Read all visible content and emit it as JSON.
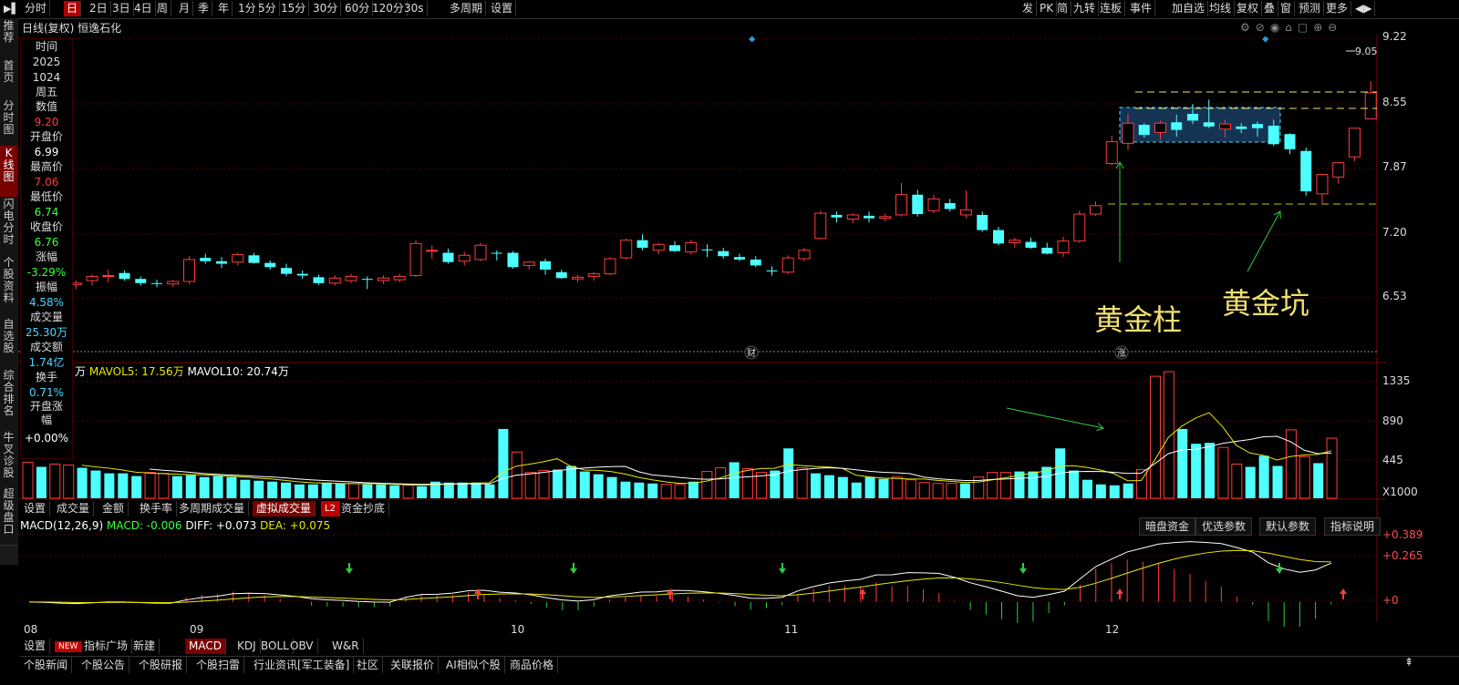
{
  "toolbar": {
    "left": [
      "分时",
      "日",
      "2日",
      "3日",
      "4日",
      "周",
      "月",
      "季",
      "年",
      "1分",
      "5分",
      "15分",
      "30分",
      "60分",
      "120分",
      "30s",
      "多周期",
      "设置"
    ],
    "active_index": 1,
    "right": [
      "发",
      "PK",
      "简",
      "九转",
      "连板",
      "事件",
      "加自选",
      "均线",
      "复权",
      "叠",
      "窗",
      "预测",
      "更多"
    ]
  },
  "leftnav": [
    "推荐",
    "首页",
    "分时图",
    "K线图",
    "闪电分时",
    "个股资料",
    "自选股",
    "综合排名",
    "牛叉诊股",
    "超级盘口"
  ],
  "leftnav_active": 3,
  "chart_title": "日线(复权)  恒逸石化",
  "info": {
    "time_label": "时间",
    "year": "2025",
    "date": "1024",
    "weekday": "周五",
    "value_label": "数值",
    "value": "9.20",
    "open_label": "开盘价",
    "open": "6.99",
    "high_label": "最高价",
    "high": "7.06",
    "low_label": "最低价",
    "low": "6.74",
    "close_label": "收盘价",
    "close": "6.76",
    "change_label": "涨幅",
    "change": "-3.29%",
    "amp_label": "振幅",
    "amp": "4.58%",
    "vol_label": "成交量",
    "vol": "25.30万",
    "amt_label": "成交额",
    "amt": "1.74亿",
    "turn_label": "换手",
    "turn": "0.71%",
    "ob_label": "开盘涨幅",
    "ob": "+0.00%"
  },
  "price_axis": [
    "9.22",
    "8.55",
    "7.87",
    "7.20",
    "6.53"
  ],
  "max_label": "9.05",
  "annotations": {
    "pillar": "黄金柱",
    "pit": "黄金坑",
    "cai": "财",
    "zhang": "涨"
  },
  "vol_legend": {
    "unit": "万",
    "mavol5": "MAVOL5: 17.56万",
    "mavol10": "MAVOL10: 20.74万"
  },
  "vol_axis": [
    "1335",
    "890",
    "445",
    "X1000"
  ],
  "vol_tabs": [
    "设置",
    "成交量",
    "金额",
    "换手率",
    "多周期成交量",
    "虚拟成交量",
    "L2",
    "资金抄底"
  ],
  "macd_legend": {
    "title": "MACD(12,26,9)",
    "macd": "MACD: -0.006",
    "diff": "DIFF: +0.073",
    "dea": "DEA: +0.075"
  },
  "macd_buttons": [
    "暗盘资金",
    "优选参数",
    "默认参数",
    "指标说明"
  ],
  "macd_axis": [
    "+0.389",
    "+0.265",
    "+0"
  ],
  "months": [
    "08",
    "09",
    "10",
    "11",
    "12"
  ],
  "indicator_tabs": [
    "设置",
    "NEW",
    "指标广场",
    "新建",
    "MACD",
    "KDJ",
    "BOLL",
    "OBV",
    "W&R"
  ],
  "bottom_tabs": [
    "个股新闻",
    "个股公告",
    "个股研报",
    "个股扫雷",
    "行业资讯[军工装备]",
    "社区",
    "关联报价",
    "AI相似个股",
    "商品价格"
  ],
  "chart_data": {
    "type": "candlestick",
    "price_ylim": [
      6.1,
      9.4
    ],
    "ohlc": [
      [
        6.48,
        6.55,
        6.4,
        6.52
      ],
      [
        6.55,
        6.6,
        6.48,
        6.49
      ],
      [
        6.53,
        6.62,
        6.43,
        6.45
      ],
      [
        6.45,
        6.5,
        6.4,
        6.47
      ],
      [
        6.5,
        6.57,
        6.44,
        6.55
      ],
      [
        6.55,
        6.63,
        6.48,
        6.56
      ],
      [
        6.59,
        6.62,
        6.5,
        6.52
      ],
      [
        6.52,
        6.55,
        6.44,
        6.47
      ],
      [
        6.47,
        6.51,
        6.42,
        6.46
      ],
      [
        6.46,
        6.51,
        6.42,
        6.49
      ],
      [
        6.49,
        6.79,
        6.46,
        6.75
      ],
      [
        6.77,
        6.82,
        6.7,
        6.73
      ],
      [
        6.73,
        6.78,
        6.65,
        6.7
      ],
      [
        6.72,
        6.83,
        6.68,
        6.81
      ],
      [
        6.8,
        6.83,
        6.7,
        6.71
      ],
      [
        6.71,
        6.74,
        6.63,
        6.66
      ],
      [
        6.65,
        6.7,
        6.55,
        6.58
      ],
      [
        6.58,
        6.62,
        6.52,
        6.56
      ],
      [
        6.54,
        6.57,
        6.45,
        6.47
      ],
      [
        6.47,
        6.56,
        6.44,
        6.53
      ],
      [
        6.5,
        6.58,
        6.47,
        6.55
      ],
      [
        6.52,
        6.55,
        6.4,
        6.51
      ],
      [
        6.5,
        6.56,
        6.46,
        6.53
      ],
      [
        6.51,
        6.58,
        6.48,
        6.55
      ],
      [
        6.56,
        6.98,
        6.54,
        6.94
      ],
      [
        6.86,
        6.92,
        6.76,
        6.86
      ],
      [
        6.83,
        6.88,
        6.7,
        6.72
      ],
      [
        6.73,
        6.84,
        6.68,
        6.8
      ],
      [
        6.75,
        6.95,
        6.73,
        6.92
      ],
      [
        6.83,
        6.86,
        6.74,
        6.82
      ],
      [
        6.83,
        6.85,
        6.64,
        6.66
      ],
      [
        6.68,
        6.73,
        6.63,
        6.72
      ],
      [
        6.73,
        6.76,
        6.57,
        6.63
      ],
      [
        6.6,
        6.63,
        6.52,
        6.53
      ],
      [
        6.52,
        6.57,
        6.48,
        6.54
      ],
      [
        6.55,
        6.6,
        6.5,
        6.58
      ],
      [
        6.58,
        6.78,
        6.56,
        6.76
      ],
      [
        6.77,
        7.0,
        6.75,
        6.98
      ],
      [
        6.98,
        7.05,
        6.86,
        6.89
      ],
      [
        6.86,
        6.95,
        6.81,
        6.93
      ],
      [
        6.92,
        6.97,
        6.84,
        6.85
      ],
      [
        6.84,
        6.98,
        6.81,
        6.95
      ],
      [
        6.87,
        6.93,
        6.78,
        6.86
      ],
      [
        6.85,
        6.89,
        6.76,
        6.79
      ],
      [
        6.78,
        6.82,
        6.73,
        6.75
      ],
      [
        6.75,
        6.79,
        6.66,
        6.68
      ],
      [
        6.62,
        6.67,
        6.56,
        6.61
      ],
      [
        6.6,
        6.8,
        6.58,
        6.77
      ],
      [
        6.76,
        6.89,
        6.73,
        6.86
      ],
      [
        7.0,
        7.33,
        6.99,
        7.3
      ],
      [
        7.28,
        7.32,
        7.19,
        7.25
      ],
      [
        7.23,
        7.3,
        7.18,
        7.28
      ],
      [
        7.27,
        7.32,
        7.19,
        7.24
      ],
      [
        7.24,
        7.3,
        7.2,
        7.26
      ],
      [
        7.28,
        7.66,
        7.26,
        7.52
      ],
      [
        7.52,
        7.58,
        7.26,
        7.29
      ],
      [
        7.33,
        7.52,
        7.3,
        7.47
      ],
      [
        7.42,
        7.47,
        7.32,
        7.35
      ],
      [
        7.28,
        7.57,
        7.24,
        7.34
      ],
      [
        7.28,
        7.32,
        7.08,
        7.1
      ],
      [
        7.1,
        7.14,
        6.92,
        6.94
      ],
      [
        6.95,
        7.01,
        6.89,
        6.98
      ],
      [
        6.96,
        7.01,
        6.88,
        6.89
      ],
      [
        6.89,
        6.95,
        6.81,
        6.82
      ],
      [
        6.83,
        7.02,
        6.78,
        6.97
      ],
      [
        6.97,
        7.33,
        6.95,
        7.29
      ],
      [
        7.29,
        7.44,
        7.27,
        7.39
      ],
      [
        7.89,
        8.22,
        7.87,
        8.15
      ],
      [
        8.13,
        8.48,
        8.05,
        8.37
      ],
      [
        8.35,
        8.37,
        8.2,
        8.23
      ],
      [
        8.26,
        8.4,
        8.17,
        8.37
      ],
      [
        8.38,
        8.47,
        8.21,
        8.29
      ],
      [
        8.48,
        8.6,
        8.36,
        8.4
      ],
      [
        8.38,
        8.65,
        8.31,
        8.33
      ],
      [
        8.3,
        8.41,
        8.2,
        8.36
      ],
      [
        8.33,
        8.37,
        8.25,
        8.3
      ],
      [
        8.36,
        8.39,
        8.21,
        8.31
      ],
      [
        8.34,
        8.41,
        8.1,
        8.12
      ],
      [
        8.24,
        8.25,
        8.0,
        8.06
      ],
      [
        8.04,
        8.08,
        7.51,
        7.56
      ],
      [
        7.53,
        7.7,
        7.42,
        7.76
      ],
      [
        7.73,
        7.91,
        7.65,
        7.9
      ],
      [
        7.97,
        8.24,
        7.92,
        8.31
      ],
      [
        8.42,
        8.87,
        8.42,
        8.73
      ]
    ],
    "volume_ylim": [
      0,
      1400
    ],
    "volume": [
      390,
      340,
      370,
      360,
      330,
      300,
      270,
      270,
      240,
      280,
      270,
      240,
      250,
      230,
      240,
      230,
      200,
      190,
      180,
      170,
      150,
      150,
      170,
      160,
      160,
      150,
      150,
      140,
      140,
      130,
      180,
      170,
      170,
      170,
      150,
      750,
      500,
      280,
      300,
      310,
      350,
      290,
      260,
      230,
      180,
      170,
      160,
      150,
      150,
      180,
      290,
      330,
      390,
      320,
      280,
      300,
      540,
      330,
      270,
      250,
      230,
      170,
      230,
      210,
      230,
      200,
      170,
      160,
      160,
      160,
      230,
      280,
      280,
      290,
      290,
      340,
      540,
      300,
      200,
      150,
      140,
      160,
      310,
      1320,
      1370,
      750,
      590,
      600,
      550,
      370,
      340,
      460,
      350,
      740,
      450,
      380,
      650
    ],
    "macd_ylim": [
      -0.13,
      0.42
    ]
  }
}
